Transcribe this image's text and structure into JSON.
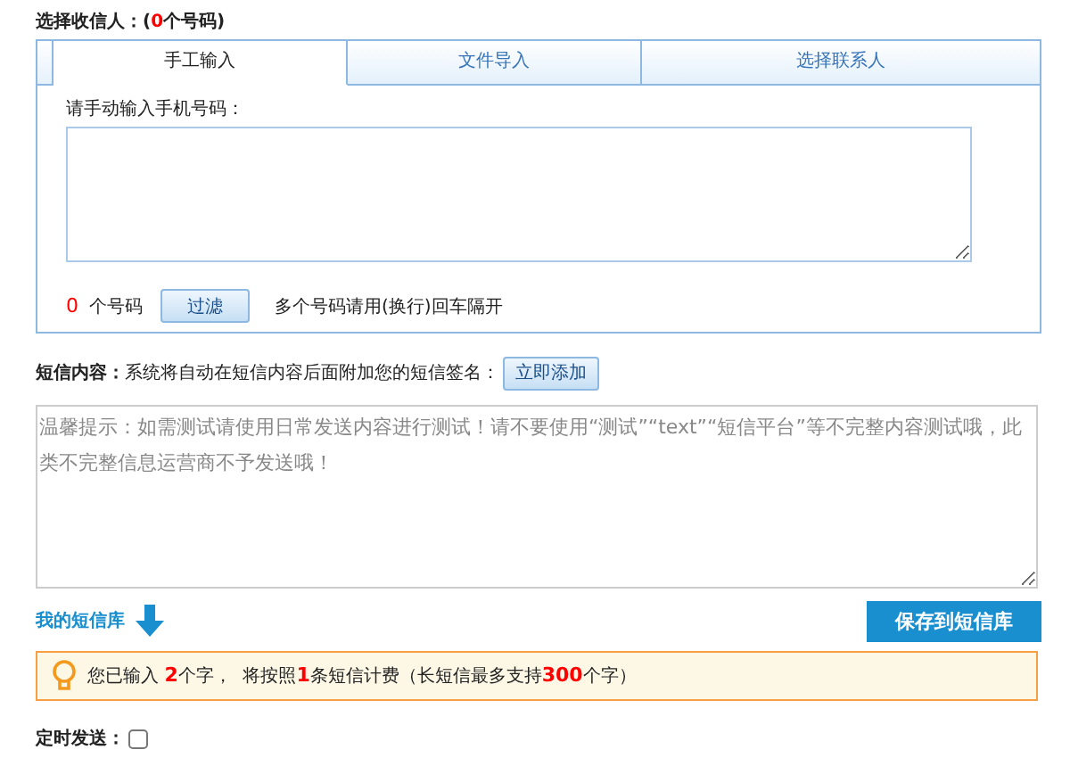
{
  "recipients": {
    "label": "选择收信人：(",
    "count": "0",
    "label_suffix": "个号码)"
  },
  "tabs": [
    {
      "label": "手工输入",
      "selected": true
    },
    {
      "label": "文件导入",
      "selected": false
    },
    {
      "label": "选择联系人",
      "selected": false
    }
  ],
  "manual": {
    "label": "请手动输入手机号码：",
    "number_count": "0",
    "number_unit": "个号码",
    "filter_button": "过滤",
    "hint": "多个号码请用(换行)回车隔开"
  },
  "content": {
    "label": "短信内容：",
    "note": "系统将自动在短信内容后面附加您的短信签名：",
    "add_button": "立即添加",
    "placeholder": "温馨提示：如需测试请使用日常发送内容进行测试！请不要使用“测试”“text”“短信平台”等不完整内容测试哦，此类不完整信息运营商不予发送哦！"
  },
  "library_link": "我的短信库",
  "save_button": "保存到短信库",
  "notice": {
    "text": "您已输入 **2**个字，  将按照**1**条短信计费（长短信最多支持**300**个字）"
  },
  "schedule": {
    "label": "定时发送：",
    "checked": false
  }
}
